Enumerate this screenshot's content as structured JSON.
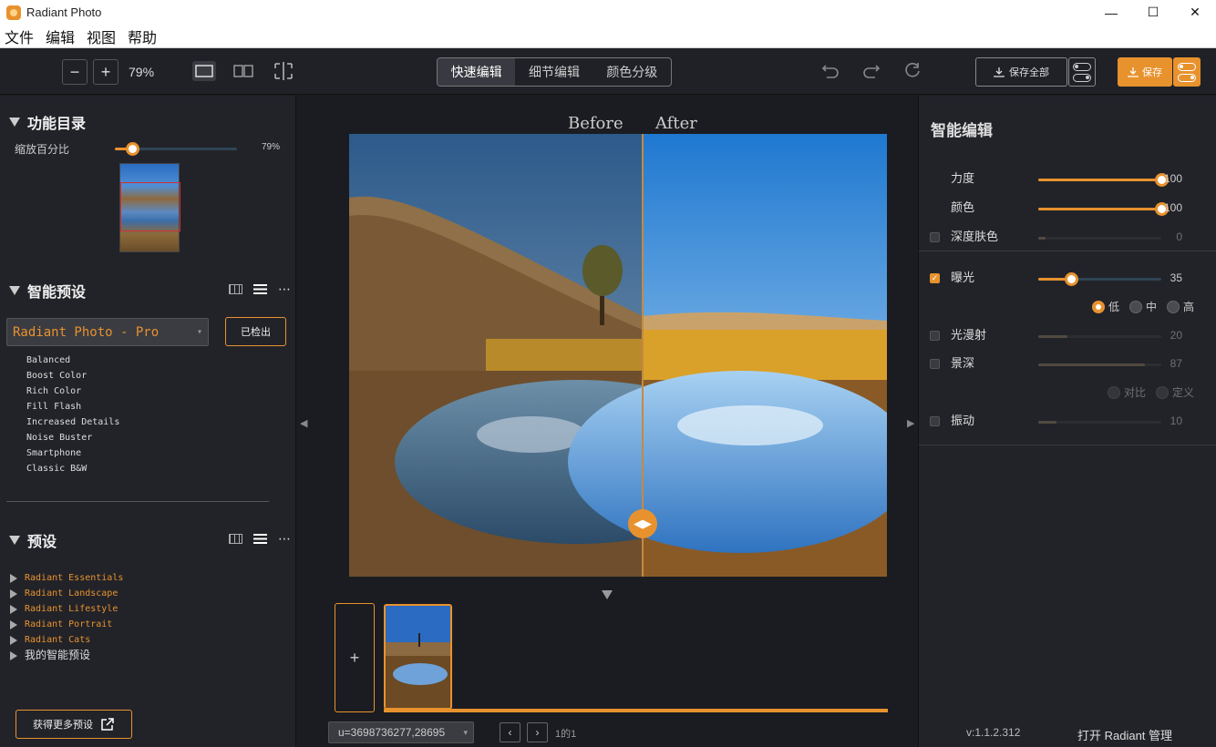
{
  "window": {
    "title": "Radiant Photo",
    "controls": [
      "—",
      "☐",
      "✕"
    ]
  },
  "menu": [
    "文件",
    "编辑",
    "视图",
    "帮助"
  ],
  "toolbar": {
    "zoom_minus": "−",
    "zoom_plus": "+",
    "zoom_value": "79%",
    "tabs": [
      {
        "label": "快速编辑",
        "active": true
      },
      {
        "label": "细节编辑",
        "active": false
      },
      {
        "label": "颜色分级",
        "active": false
      }
    ],
    "save_all": "保存全部",
    "save": "保存"
  },
  "left": {
    "catalog_title": "功能目录",
    "zoom_label": "缩放百分比",
    "zoom_pct": "79%",
    "zoom_fraction": 0.14,
    "smart_presets_title": "智能预设",
    "preset_dropdown": "Radiant Photo - Pro",
    "detect_button": "已检出",
    "presets": [
      "Balanced",
      "Boost Color",
      "Rich Color",
      "Fill Flash",
      "Increased Details",
      "Noise Buster",
      "Smartphone",
      "Classic B&W"
    ],
    "presets_title": "预设",
    "folders": [
      {
        "label": "Radiant Essentials",
        "accent": true
      },
      {
        "label": "Radiant Landscape",
        "accent": true
      },
      {
        "label": "Radiant Lifestyle",
        "accent": true
      },
      {
        "label": "Radiant Portrait",
        "accent": true
      },
      {
        "label": "Radiant Cats",
        "accent": true
      },
      {
        "label": "我的智能预设",
        "accent": false
      }
    ],
    "more_presets": "获得更多预设"
  },
  "center": {
    "before_label": "Before",
    "after_label": "After",
    "add_label": "+",
    "image_id": "u=3698736277,28695",
    "prev": "‹",
    "next": "›",
    "page": "1的1"
  },
  "right": {
    "title": "智能编辑",
    "rows": [
      {
        "label": "力度",
        "value": "100",
        "level": 1.0,
        "checkbox": null,
        "knob": true,
        "dim": false
      },
      {
        "label": "颜色",
        "value": "100",
        "level": 1.0,
        "checkbox": null,
        "knob": true,
        "dim": false
      },
      {
        "label": "深度肤色",
        "value": "0",
        "level": 0.06,
        "checkbox": false,
        "knob": false,
        "dim": true
      },
      {
        "label": "曝光",
        "value": "35",
        "level": 0.27,
        "checkbox": true,
        "knob": true,
        "dim": false
      },
      {
        "label": "光漫射",
        "value": "20",
        "level": 0.24,
        "checkbox": false,
        "knob": false,
        "dim": true
      },
      {
        "label": "景深",
        "value": "87",
        "level": 0.87,
        "checkbox": false,
        "knob": false,
        "dim": true
      },
      {
        "label": "振动",
        "value": "10",
        "level": 0.15,
        "checkbox": false,
        "knob": false,
        "dim": true
      }
    ],
    "exposure_options": [
      {
        "label": "低",
        "selected": true
      },
      {
        "label": "中",
        "selected": false
      },
      {
        "label": "高",
        "selected": false
      }
    ],
    "depth_options": [
      {
        "label": "对比",
        "selected": false
      },
      {
        "label": "定义",
        "selected": false
      }
    ],
    "version": "v:1.1.2.312",
    "open_label": "打开 Radiant 管理"
  },
  "colors": {
    "accent": "#e8922e",
    "panel": "#222329",
    "background": "#1b1c21"
  }
}
